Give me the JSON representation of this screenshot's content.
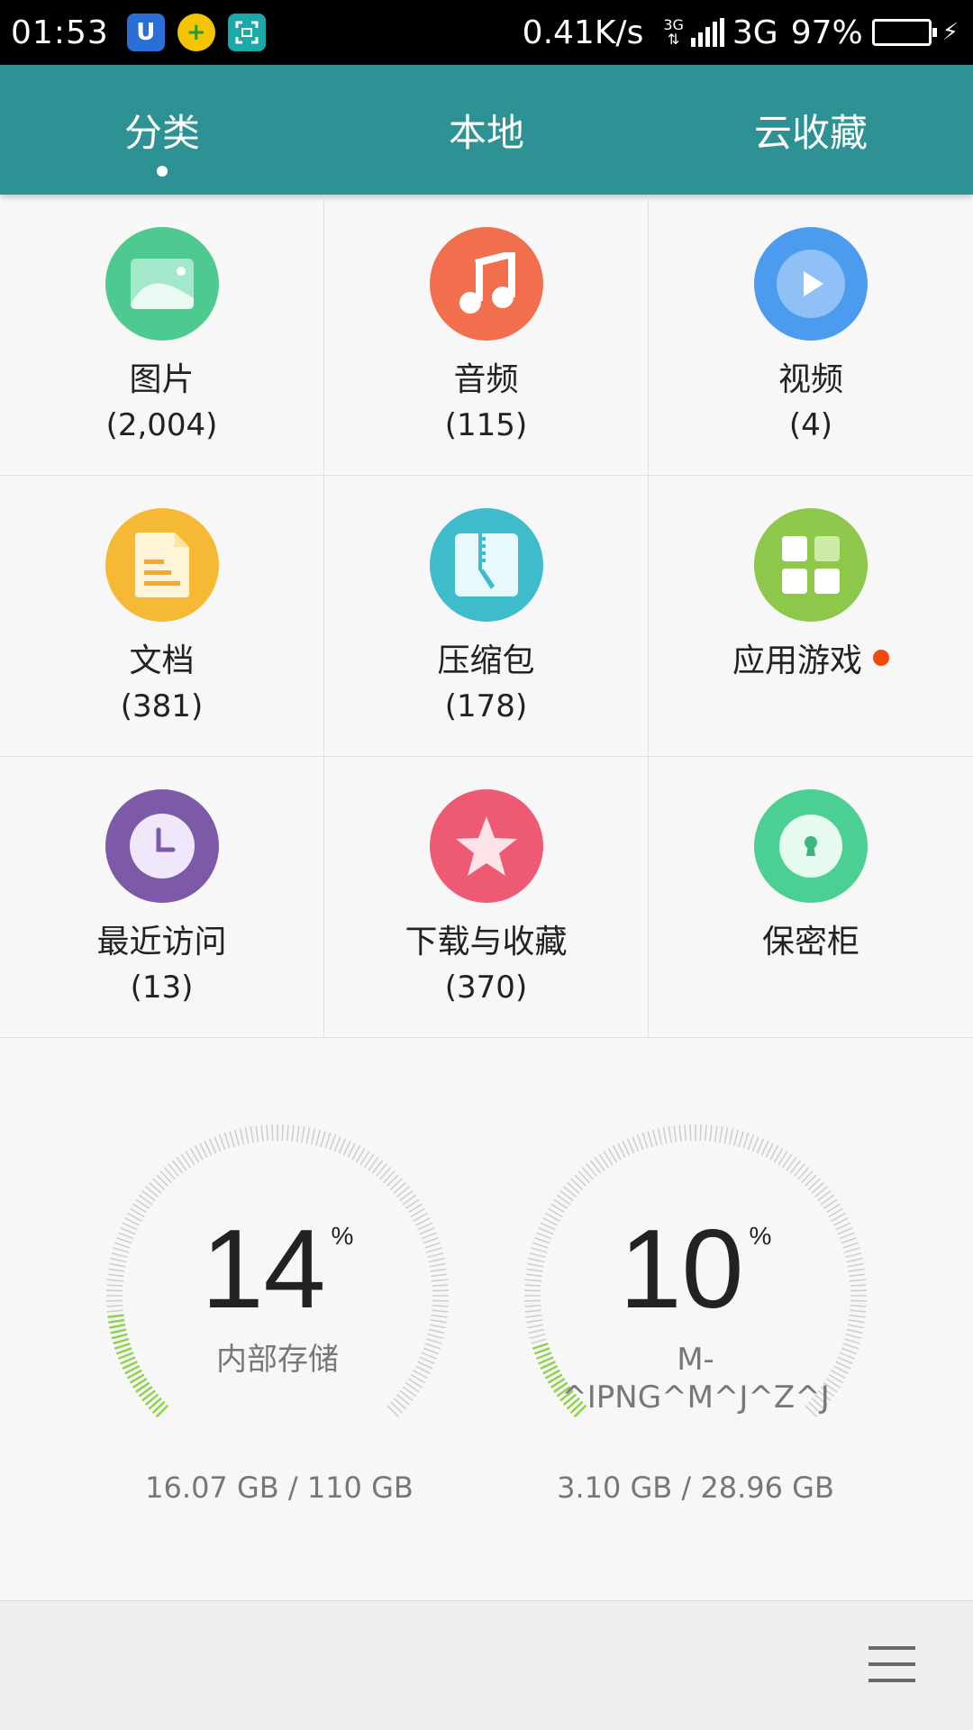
{
  "status": {
    "time": "01:53",
    "speed": "0.41K/s",
    "net_small": "3G",
    "net": "3G",
    "battery": "97%"
  },
  "tabs": [
    {
      "label": "分类",
      "active": true
    },
    {
      "label": "本地",
      "active": false
    },
    {
      "label": "云收藏",
      "active": false
    }
  ],
  "categories": [
    {
      "label": "图片",
      "count": "(2,004)",
      "icon": "image-icon",
      "color": "#4ec98f"
    },
    {
      "label": "音频",
      "count": "(115)",
      "icon": "music-icon",
      "color": "#f26f4e"
    },
    {
      "label": "视频",
      "count": "(4)",
      "icon": "play-icon",
      "color": "#4b9bef"
    },
    {
      "label": "文档",
      "count": "(381)",
      "icon": "document-icon",
      "color": "#f6b935"
    },
    {
      "label": "压缩包",
      "count": "(178)",
      "icon": "zip-icon",
      "color": "#3fbccb"
    },
    {
      "label": "应用游戏",
      "count": "",
      "icon": "apps-icon",
      "color": "#8dc84a"
    },
    {
      "label": "最近访问",
      "count": "(13)",
      "icon": "clock-icon",
      "color": "#7d5aa7"
    },
    {
      "label": "下载与收藏",
      "count": "(370)",
      "icon": "star-icon",
      "color": "#ee5a74"
    },
    {
      "label": "保密柜",
      "count": "",
      "icon": "lock-icon",
      "color": "#4ccf92"
    }
  ],
  "storage": [
    {
      "percent": 14,
      "percent_text": "14",
      "unit": "%",
      "name": "内部存储",
      "size": "16.07 GB / 110 GB"
    },
    {
      "percent": 10,
      "percent_text": "10",
      "unit": "%",
      "name": "M-\n^IPNG^M^J^Z^J",
      "size": "3.10 GB / 28.96 GB"
    }
  ],
  "colors": {
    "header": "#2e9295",
    "accent_green": "#8cd14a",
    "badge_red": "#f04a0e"
  }
}
